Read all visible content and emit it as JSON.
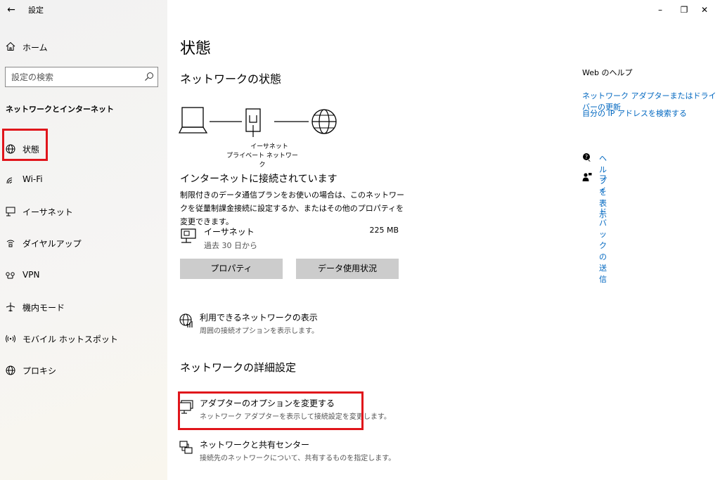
{
  "window": {
    "title": "設定",
    "controls": {
      "minimize": "–",
      "restore": "❐",
      "close": "✕"
    }
  },
  "sidebar": {
    "home_label": "ホーム",
    "search_placeholder": "設定の検索",
    "section_title": "ネットワークとインターネット",
    "items": [
      {
        "label": "状態",
        "icon": "status-globe-icon",
        "selected": true
      },
      {
        "label": "Wi-Fi",
        "icon": "wifi-icon"
      },
      {
        "label": "イーサネット",
        "icon": "ethernet-icon"
      },
      {
        "label": "ダイヤルアップ",
        "icon": "dialup-icon"
      },
      {
        "label": "VPN",
        "icon": "vpn-icon"
      },
      {
        "label": "機内モード",
        "icon": "airplane-icon"
      },
      {
        "label": "モバイル ホットスポット",
        "icon": "hotspot-icon"
      },
      {
        "label": "プロキシ",
        "icon": "globe-icon"
      }
    ]
  },
  "main": {
    "title": "状態",
    "network_status_heading": "ネットワークの状態",
    "diagram": {
      "adapter_name": "イーサネット",
      "profile": "プライベート ネットワーク"
    },
    "connection_title": "インターネットに接続されています",
    "connection_desc": "制限付きのデータ通信プランをお使いの場合は、このネットワークを従量制課金接続に設定するか、またはその他のプロパティを変更できます。",
    "ethernet": {
      "name": "イーサネット",
      "period": "過去 30 日から",
      "usage": "225 MB"
    },
    "buttons": {
      "properties": "プロパティ",
      "data_usage": "データ使用状況"
    },
    "available_networks": {
      "title": "利用できるネットワークの表示",
      "desc": "周囲の接続オプションを表示します。"
    },
    "advanced_heading": "ネットワークの詳細設定",
    "adapter_options": {
      "title": "アダプターのオプションを変更する",
      "desc": "ネットワーク アダプターを表示して接続設定を変更します。"
    },
    "sharing_center": {
      "title": "ネットワークと共有センター",
      "desc": "接続先のネットワークについて、共有するものを指定します。"
    }
  },
  "help": {
    "heading": "Web のヘルプ",
    "links": [
      "ネットワーク アダプターまたはドライバーの更新",
      "自分の IP アドレスを検索する"
    ],
    "show_help": "ヘルプを表示",
    "feedback": "フィードバックの送信"
  },
  "colors": {
    "accent": "#0067c0",
    "highlight": "#e0151b",
    "button": "#cccccc"
  }
}
